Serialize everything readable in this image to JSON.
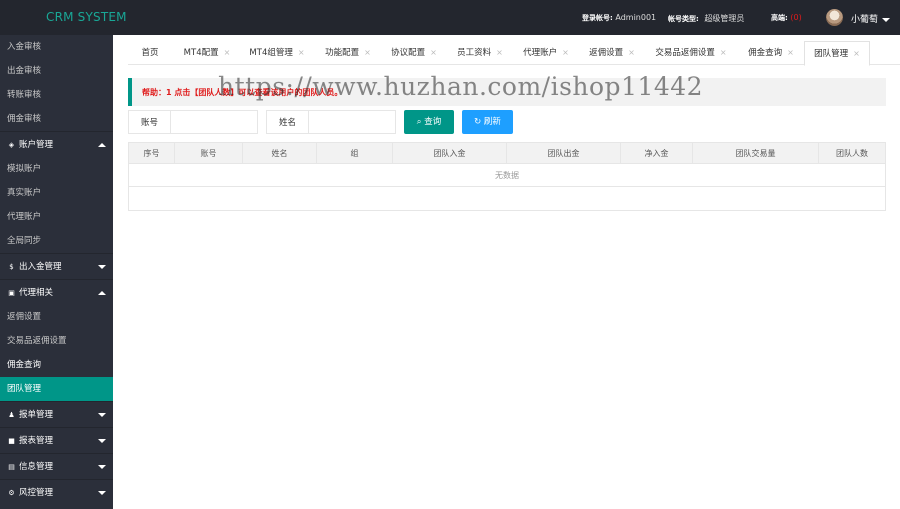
{
  "header": {
    "brand": "CRM SYSTEM",
    "login_label": "登录帐号:",
    "login_value": "Admin001",
    "type_label": "帐号类型:",
    "type_value": "超级管理员",
    "balance_label": "高端:",
    "balance_value": "(0)",
    "username": "小葡萄"
  },
  "sidebar": {
    "items": [
      {
        "label": "入金审核"
      },
      {
        "label": "出金审核"
      },
      {
        "label": "转账审核"
      },
      {
        "label": "佣金审核"
      }
    ],
    "group_account": "账户管理",
    "account_items": [
      {
        "label": "模拟账户"
      },
      {
        "label": "真实账户"
      },
      {
        "label": "代理账户"
      },
      {
        "label": "全局同步"
      }
    ],
    "group_funds": "出入金管理",
    "group_agent": "代理相关",
    "agent_items": [
      {
        "label": "返佣设置"
      },
      {
        "label": "交易品返佣设置"
      },
      {
        "label": "佣金查询"
      },
      {
        "label": "团队管理"
      }
    ],
    "group_orders": "报单管理",
    "group_reports": "报表管理",
    "group_info": "信息管理",
    "group_risk": "风控管理"
  },
  "tabs": [
    {
      "label": "首页"
    },
    {
      "label": "MT4配置"
    },
    {
      "label": "MT4组管理"
    },
    {
      "label": "功能配置"
    },
    {
      "label": "协议配置"
    },
    {
      "label": "员工资料"
    },
    {
      "label": "代理账户"
    },
    {
      "label": "返佣设置"
    },
    {
      "label": "交易品返佣设置"
    },
    {
      "label": "佣金查询"
    },
    {
      "label": "团队管理"
    }
  ],
  "tab_close": "×",
  "help": {
    "text": "帮助：1 点击【团队人数】可以查看该用户的团队人员。"
  },
  "watermark": "https://www.huzhan.com/ishop11442",
  "search": {
    "account_label": "账号",
    "account_value": "",
    "name_label": "姓名",
    "name_value": "",
    "query_button": "查询",
    "refresh_button": "刷新"
  },
  "table": {
    "columns": [
      "序号",
      "账号",
      "姓名",
      "组",
      "团队入金",
      "团队出金",
      "净入金",
      "团队交易量",
      "团队人数"
    ],
    "empty_text": "无数据"
  }
}
